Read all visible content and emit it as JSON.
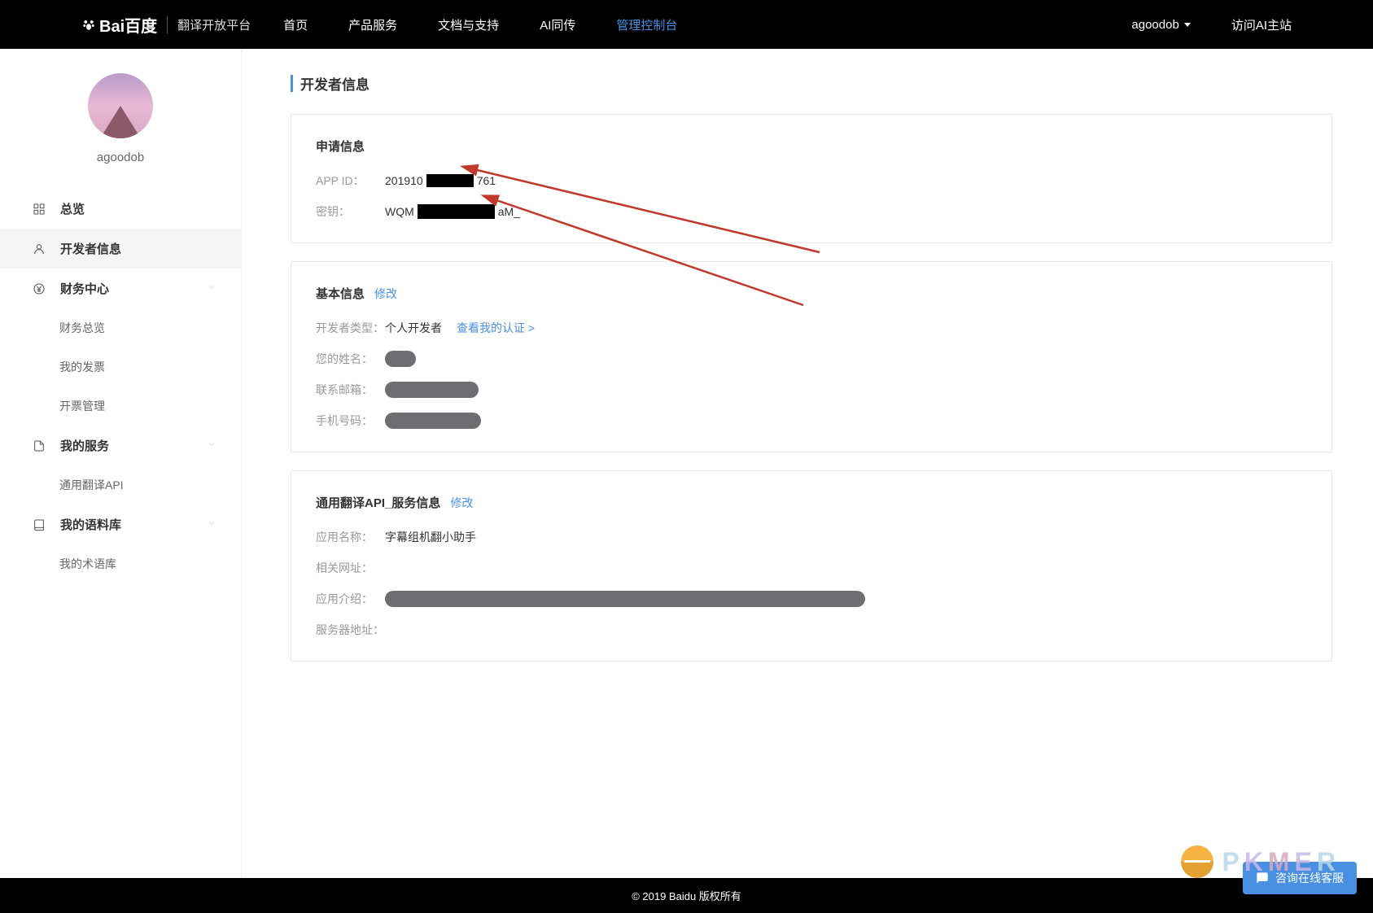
{
  "header": {
    "logo_text": "Bai百度",
    "platform": "翻译开放平台",
    "nav": [
      "首页",
      "产品服务",
      "文档与支持",
      "AI同传",
      "管理控制台"
    ],
    "active_nav_index": 4,
    "username": "agoodob",
    "ai_link": "访问AI主站"
  },
  "sidebar": {
    "username": "agoodob",
    "items": [
      {
        "label": "总览",
        "icon": "grid"
      },
      {
        "label": "开发者信息",
        "icon": "user",
        "active": true
      },
      {
        "label": "财务中心",
        "icon": "yen",
        "expandable": true,
        "children": [
          "财务总览",
          "我的发票",
          "开票管理"
        ]
      },
      {
        "label": "我的服务",
        "icon": "file",
        "expandable": true,
        "children": [
          "通用翻译API"
        ]
      },
      {
        "label": "我的语料库",
        "icon": "book",
        "expandable": true,
        "children": [
          "我的术语库"
        ]
      }
    ]
  },
  "page": {
    "title": "开发者信息"
  },
  "card_apply": {
    "title": "申请信息",
    "app_id_label": "APP ID：",
    "app_id_prefix": "201910",
    "app_id_suffix": "761",
    "secret_label": "密钥：",
    "secret_prefix": "WQM",
    "secret_suffix": "aM_"
  },
  "card_basic": {
    "title": "基本信息",
    "modify": "修改",
    "dev_type_label": "开发者类型：",
    "dev_type_value": "个人开发者",
    "view_auth": "查看我的认证 >",
    "name_label": "您的姓名：",
    "email_label": "联系邮箱：",
    "phone_label": "手机号码："
  },
  "card_service": {
    "title": "通用翻译API_服务信息",
    "modify": "修改",
    "app_name_label": "应用名称：",
    "app_name_value": "字幕组机翻小助手",
    "url_label": "相关网址：",
    "intro_label": "应用介绍：",
    "server_label": "服务器地址："
  },
  "footer": {
    "copyright": "© 2019 Baidu 版权所有"
  },
  "chat": {
    "label": "咨询在线客服"
  },
  "watermark": {
    "text": "PKMER"
  }
}
